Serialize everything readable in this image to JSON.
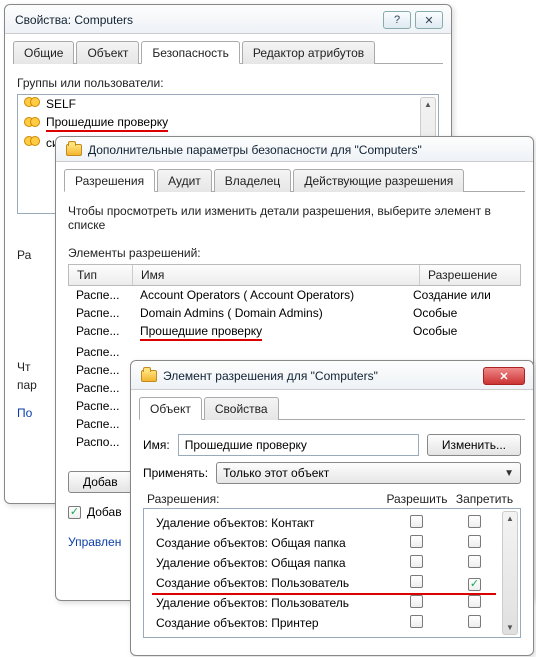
{
  "win1": {
    "title": "Свойства: Computers",
    "tabs": {
      "general": "Общие",
      "object": "Объект",
      "security": "Безопасность",
      "attrs": "Редактор атрибутов"
    },
    "groups_label": "Группы или пользователи:",
    "list": {
      "self": "SELF",
      "auth": "Прошедшие проверку",
      "sys": "система"
    },
    "perm_label_prefix": "Ра",
    "this_label_prefix": "Чт",
    "param_label_prefix": "пар",
    "add_btn": "По",
    "raspe_col": "Распе...",
    "raspo_col": "Распо..."
  },
  "win2": {
    "title": "Дополнительные параметры безопасности  для \"Computers\"",
    "tabs": {
      "perm": "Разрешения",
      "audit": "Аудит",
      "owner": "Владелец",
      "eff": "Действующие разрешения"
    },
    "help": "Чтобы просмотреть или изменить детали разрешения, выберите элемент в списке",
    "entries_label": "Элементы разрешений:",
    "cols": {
      "type": "Тип",
      "name": "Имя",
      "perm": "Разрешение"
    },
    "rows": [
      {
        "type": "Распе...",
        "name": "Account Operators (               Account Operators)",
        "perm": "Создание или"
      },
      {
        "type": "Распе...",
        "name": "Domain Admins (              Domain Admins)",
        "perm": "Особые"
      },
      {
        "type": "Распе...",
        "name": "Прошедшие проверку",
        "perm": "Особые"
      }
    ],
    "add_btn": "Добав",
    "also_label": "Добав",
    "manage_link": "Управлен"
  },
  "win3": {
    "title": "Элемент разрешения для \"Computers\"",
    "tabs": {
      "object": "Объект",
      "props": "Свойства"
    },
    "name_label": "Имя:",
    "name_value": "Прошедшие проверку",
    "change_btn": "Изменить...",
    "apply_label": "Применять:",
    "apply_value": "Только этот объект",
    "perm_label": "Разрешения:",
    "allow": "Разрешить",
    "deny": "Запретить",
    "perms": [
      {
        "text": "Удаление объектов: Контакт",
        "allow": false,
        "deny": false
      },
      {
        "text": "Создание объектов: Общая папка",
        "allow": false,
        "deny": false
      },
      {
        "text": "Удаление объектов: Общая папка",
        "allow": false,
        "deny": false
      },
      {
        "text": "Создание объектов: Пользователь",
        "allow": false,
        "deny": true
      },
      {
        "text": "Удаление объектов: Пользователь",
        "allow": false,
        "deny": false
      },
      {
        "text": "Создание объектов: Принтер",
        "allow": false,
        "deny": false
      }
    ]
  }
}
